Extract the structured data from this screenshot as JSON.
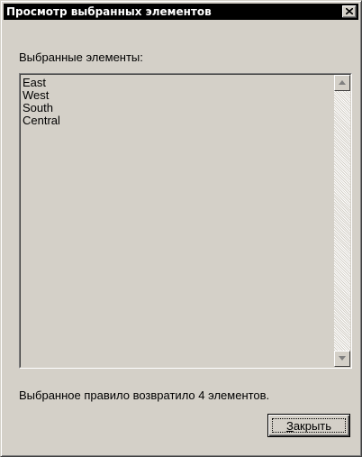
{
  "window": {
    "title": "Просмотр выбранных элементов"
  },
  "titlebar": {
    "close_icon": "close-icon"
  },
  "list": {
    "label": "Выбранные элементы:",
    "items": [
      "East",
      "West",
      "South",
      "Central"
    ],
    "scroll_up_icon": "scroll-up-arrow-icon",
    "scroll_down_icon": "scroll-down-arrow-icon"
  },
  "status": {
    "text": "Выбранное правило возвратило 4 элементов."
  },
  "buttons": {
    "close_label_mnemonic": "З",
    "close_label_rest": "акрыть"
  }
}
